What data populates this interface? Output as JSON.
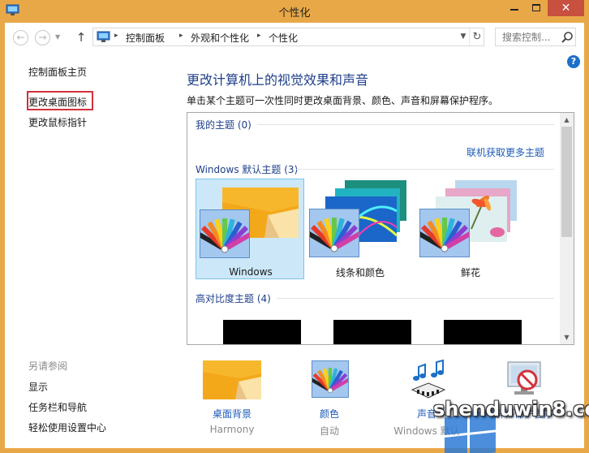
{
  "window": {
    "title": "个性化",
    "close_glyph": "✕"
  },
  "nav": {
    "back_glyph": "←",
    "forward_glyph": "→",
    "recent_glyph": "▼",
    "up_glyph": "↑",
    "crumbs": [
      "控制面板",
      "外观和个性化",
      "个性化"
    ],
    "crumb_sep": "▸",
    "dropdown_glyph": "▼",
    "refresh_glyph": "↻",
    "search_placeholder": "搜索控制..."
  },
  "help_glyph": "?",
  "sidebar": {
    "links": [
      "控制面板主页",
      "更改桌面图标",
      "更改鼠标指针"
    ],
    "see_also_header": "另请参阅",
    "see_also": [
      "显示",
      "任务栏和导航",
      "轻松使用设置中心"
    ]
  },
  "main": {
    "title": "更改计算机上的视觉效果和声音",
    "description": "单击某个主题可一次性同时更改桌面背景、颜色、声音和屏幕保护程序。"
  },
  "themes": {
    "my_themes": "我的主题 (0)",
    "online_link": "联机获取更多主题",
    "default_header": "Windows 默认主题 (3)",
    "default_items": [
      {
        "label": "Windows",
        "selected": true
      },
      {
        "label": "线条和颜色",
        "selected": false
      },
      {
        "label": "鲜花",
        "selected": false
      }
    ],
    "high_contrast_header": "高对比度主题 (4)"
  },
  "scrollbar": {
    "up_glyph": "▲",
    "down_glyph": "▼"
  },
  "settings": [
    {
      "label": "桌面背景",
      "sub": "Harmony"
    },
    {
      "label": "颜色",
      "sub": "自动"
    },
    {
      "label": "声音",
      "sub": "Windows 默认"
    },
    {
      "label": "屏幕保护程序",
      "sub": ""
    }
  ],
  "watermark": "shenduwin8.com",
  "colors": {
    "title_bar": "#e9a848",
    "close_button": "#c7503f",
    "heading_blue": "#1e3f8a",
    "link_blue": "#1c5bb8",
    "highlight_red": "#d3323b",
    "selection_bg": "#cce8f8"
  }
}
